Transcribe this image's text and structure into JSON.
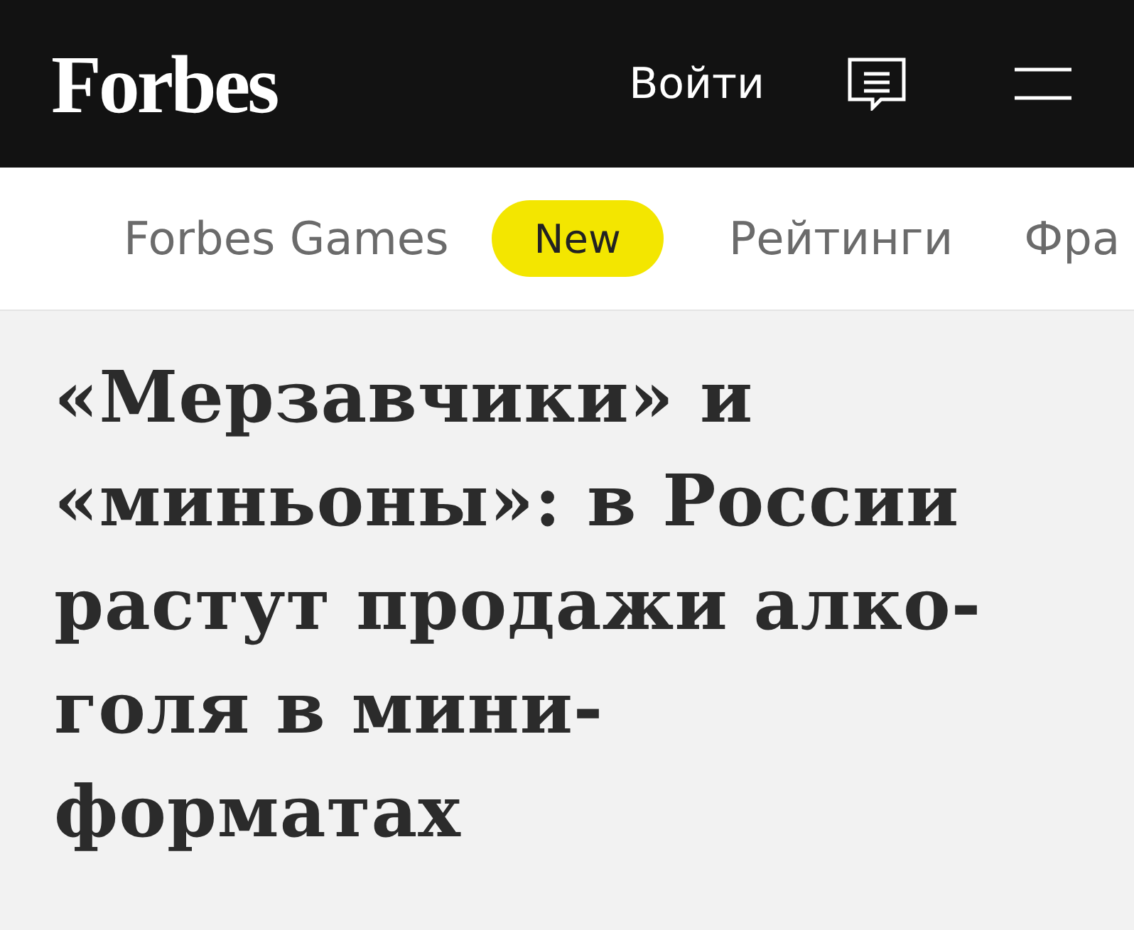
{
  "header": {
    "logo": "Forbes",
    "login": "Войти"
  },
  "nav": [
    {
      "label": "Forbes Games",
      "kind": "link"
    },
    {
      "label": "New",
      "kind": "badge"
    },
    {
      "label": "Рейтинги",
      "kind": "link"
    },
    {
      "label": "Фра",
      "kind": "link"
    }
  ],
  "headline_lines": [
    "«Мерзавчики» и",
    "«миньоны»: в России",
    "растут продажи алко-",
    "голя в мини-",
    "форматах"
  ]
}
